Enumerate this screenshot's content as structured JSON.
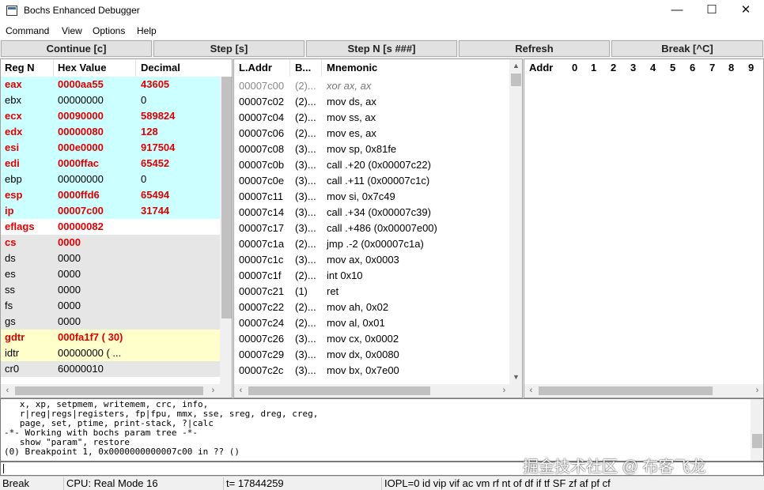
{
  "window": {
    "title": "Bochs Enhanced Debugger",
    "minimize": "—",
    "maximize": "☐",
    "close": "✕"
  },
  "menu": [
    "Command",
    "View",
    "Options",
    "Help"
  ],
  "toolbar": {
    "continue": "Continue [c]",
    "step": "Step [s]",
    "step_n": "Step N [s ###]",
    "refresh": "Refresh",
    "break": "Break [^C]"
  },
  "registers": {
    "headers": [
      "Reg N",
      "Hex Value",
      "Decimal"
    ],
    "rows": [
      {
        "name": "eax",
        "hex": "0000aa55",
        "dec": "43605",
        "changed": true
      },
      {
        "name": "ebx",
        "hex": "00000000",
        "dec": "0",
        "changed": false
      },
      {
        "name": "ecx",
        "hex": "00090000",
        "dec": "589824",
        "changed": true
      },
      {
        "name": "edx",
        "hex": "00000080",
        "dec": "128",
        "changed": true
      },
      {
        "name": "esi",
        "hex": "000e0000",
        "dec": "917504",
        "changed": true
      },
      {
        "name": "edi",
        "hex": "0000ffac",
        "dec": "65452",
        "changed": true
      },
      {
        "name": "ebp",
        "hex": "00000000",
        "dec": "0",
        "changed": false
      },
      {
        "name": "esp",
        "hex": "0000ffd6",
        "dec": "65494",
        "changed": true
      },
      {
        "name": "ip",
        "hex": "00007c00",
        "dec": "31744",
        "changed": true
      },
      {
        "name": "eflags",
        "hex": "00000082",
        "dec": "",
        "changed": true
      },
      {
        "name": "cs",
        "hex": "0000",
        "dec": "",
        "changed": true
      },
      {
        "name": "ds",
        "hex": "0000",
        "dec": "",
        "changed": false
      },
      {
        "name": "es",
        "hex": "0000",
        "dec": "",
        "changed": false
      },
      {
        "name": "ss",
        "hex": "0000",
        "dec": "",
        "changed": false
      },
      {
        "name": "fs",
        "hex": "0000",
        "dec": "",
        "changed": false
      },
      {
        "name": "gs",
        "hex": "0000",
        "dec": "",
        "changed": false
      },
      {
        "name": "gdtr",
        "hex": "000fa1f7 ( 30)",
        "dec": "",
        "changed": true
      },
      {
        "name": "idtr",
        "hex": "00000000 ( ...",
        "dec": "",
        "changed": false
      },
      {
        "name": "cr0",
        "hex": "60000010",
        "dec": "",
        "changed": false
      }
    ]
  },
  "disasm": {
    "headers": [
      "L.Addr",
      "B...",
      "Mnemonic"
    ],
    "rows": [
      {
        "addr": "00007c00",
        "bytes": "(2)...",
        "mnem": "xor ax, ax"
      },
      {
        "addr": "00007c02",
        "bytes": "(2)...",
        "mnem": "mov ds, ax"
      },
      {
        "addr": "00007c04",
        "bytes": "(2)...",
        "mnem": "mov ss, ax"
      },
      {
        "addr": "00007c06",
        "bytes": "(2)...",
        "mnem": "mov es, ax"
      },
      {
        "addr": "00007c08",
        "bytes": "(3)...",
        "mnem": "mov sp, 0x81fe"
      },
      {
        "addr": "00007c0b",
        "bytes": "(3)...",
        "mnem": "call .+20 (0x00007c22)"
      },
      {
        "addr": "00007c0e",
        "bytes": "(3)...",
        "mnem": "call .+11 (0x00007c1c)"
      },
      {
        "addr": "00007c11",
        "bytes": "(3)...",
        "mnem": "mov si, 0x7c49"
      },
      {
        "addr": "00007c14",
        "bytes": "(3)...",
        "mnem": "call .+34 (0x00007c39)"
      },
      {
        "addr": "00007c17",
        "bytes": "(3)...",
        "mnem": "call .+486 (0x00007e00)"
      },
      {
        "addr": "00007c1a",
        "bytes": "(2)...",
        "mnem": "jmp .-2 (0x00007c1a)"
      },
      {
        "addr": "00007c1c",
        "bytes": "(3)...",
        "mnem": "mov ax, 0x0003"
      },
      {
        "addr": "00007c1f",
        "bytes": "(2)...",
        "mnem": "int 0x10"
      },
      {
        "addr": "00007c21",
        "bytes": "(1)",
        "mnem": "ret"
      },
      {
        "addr": "00007c22",
        "bytes": "(2)...",
        "mnem": "mov ah, 0x02"
      },
      {
        "addr": "00007c24",
        "bytes": "(2)...",
        "mnem": "mov al, 0x01"
      },
      {
        "addr": "00007c26",
        "bytes": "(3)...",
        "mnem": "mov cx, 0x0002"
      },
      {
        "addr": "00007c29",
        "bytes": "(3)...",
        "mnem": "mov dx, 0x0080"
      },
      {
        "addr": "00007c2c",
        "bytes": "(3)...",
        "mnem": "mov bx, 0x7e00"
      }
    ]
  },
  "memory": {
    "headers": [
      "Addr",
      "0",
      "1",
      "2",
      "3",
      "4",
      "5",
      "6",
      "7",
      "8",
      "9"
    ]
  },
  "output": [
    "   x, xp, setpmem, writemem, crc, info,",
    "   r|reg|regs|registers, fp|fpu, mmx, sse, sreg, dreg, creg,",
    "   page, set, ptime, print-stack, ?|calc",
    "-*- Working with bochs param tree -*-",
    "   show \"param\", restore",
    "(0) Breakpoint 1, 0x0000000000007c00 in ?? ()"
  ],
  "watermark": "掘金技术社区 @ 布客飞龙",
  "status": {
    "state": "Break",
    "cpu": "CPU: Real Mode 16",
    "ticks": "t= 17844259",
    "flags": "IOPL=0 id vip vif ac vm rf nt of df if tf SF zf af pf cf"
  },
  "colors": {
    "register_highlight": "#ccffff",
    "segment_gray": "#e6e6e6",
    "gdt_yellow": "#ffffcc",
    "changed_red": "#e00000"
  }
}
